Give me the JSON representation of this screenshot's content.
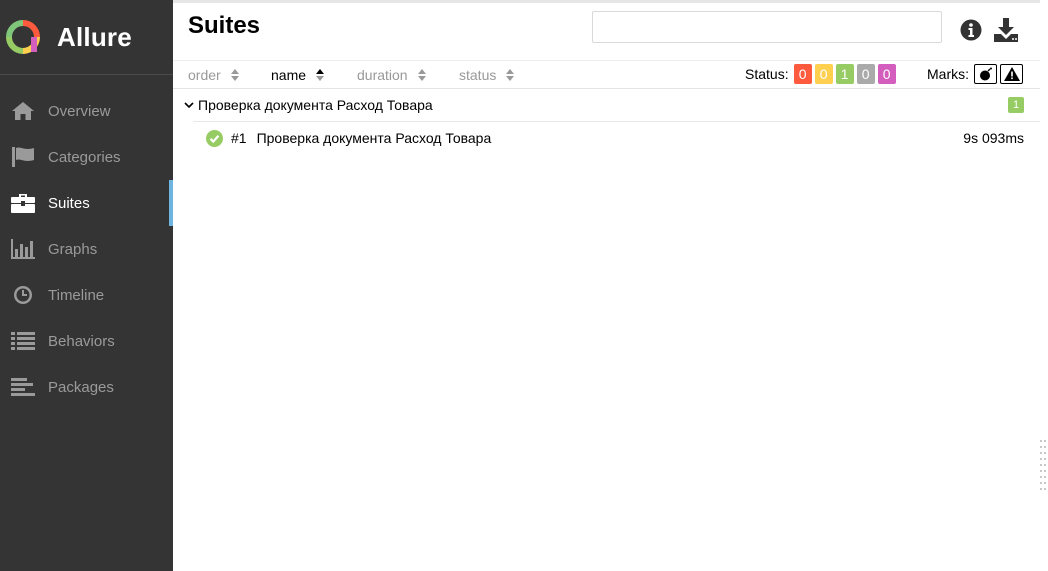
{
  "brand": {
    "name": "Allure"
  },
  "sidebar": {
    "items": [
      {
        "label": "Overview",
        "icon": "home-icon"
      },
      {
        "label": "Categories",
        "icon": "flag-icon"
      },
      {
        "label": "Suites",
        "icon": "briefcase-icon",
        "active": true
      },
      {
        "label": "Graphs",
        "icon": "bar-chart-icon"
      },
      {
        "label": "Timeline",
        "icon": "clock-icon"
      },
      {
        "label": "Behaviors",
        "icon": "list-icon"
      },
      {
        "label": "Packages",
        "icon": "align-left-icon"
      }
    ]
  },
  "header": {
    "title": "Suites",
    "search_value": "",
    "search_placeholder": ""
  },
  "sort": {
    "order": "order",
    "name": "name",
    "duration": "duration",
    "status": "status"
  },
  "status_filter": {
    "label": "Status:",
    "badges": [
      {
        "value": "0",
        "color": "#fd5a3e"
      },
      {
        "value": "0",
        "color": "#ffd050"
      },
      {
        "value": "1",
        "color": "#97cc64"
      },
      {
        "value": "0",
        "color": "#aaaaaa"
      },
      {
        "value": "0",
        "color": "#d35ebe"
      }
    ]
  },
  "marks": {
    "label": "Marks:"
  },
  "tree": {
    "group": {
      "name": "Проверка документа Расход Товара",
      "count": "1"
    },
    "tests": [
      {
        "num": "#1",
        "name": "Проверка документа Расход Товара",
        "duration": "9s 093ms",
        "status": "passed"
      }
    ]
  },
  "colors": {
    "sidebar_bg": "#343434",
    "accent": "#6eb4e0",
    "passed": "#97cc64"
  }
}
